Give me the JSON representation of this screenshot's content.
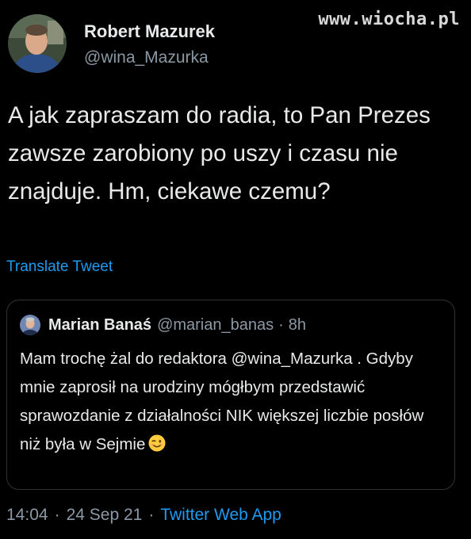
{
  "watermark": "www.wiocha.pl",
  "author": {
    "display_name": "Robert Mazurek",
    "handle": "@wina_Mazurka"
  },
  "tweet": {
    "text": "A jak zapraszam do radia, to Pan Prezes zawsze zarobiony po uszy i czasu nie znajduje. Hm, ciekawe czemu?",
    "translate_label": "Translate Tweet"
  },
  "quoted_tweet": {
    "display_name": "Marian Banaś",
    "handle": "@marian_banas",
    "separator": "·",
    "time": "8h",
    "text": "Mam trochę żal do redaktora @wina_Mazurka . Gdyby mnie zaprosił na urodziny mógłbym przedstawić sprawozdanie z działalności NIK większej liczbie posłów niż była w Sejmie",
    "emoji_icon": "winking-face-emoji"
  },
  "meta": {
    "time": "14:04",
    "date": "24 Sep 21",
    "separator": "·",
    "source": "Twitter Web App"
  },
  "colors": {
    "background": "#000000",
    "text": "#e7e9ea",
    "secondary": "#8b98a5",
    "link": "#1d9bf0",
    "border": "#2f3336"
  }
}
